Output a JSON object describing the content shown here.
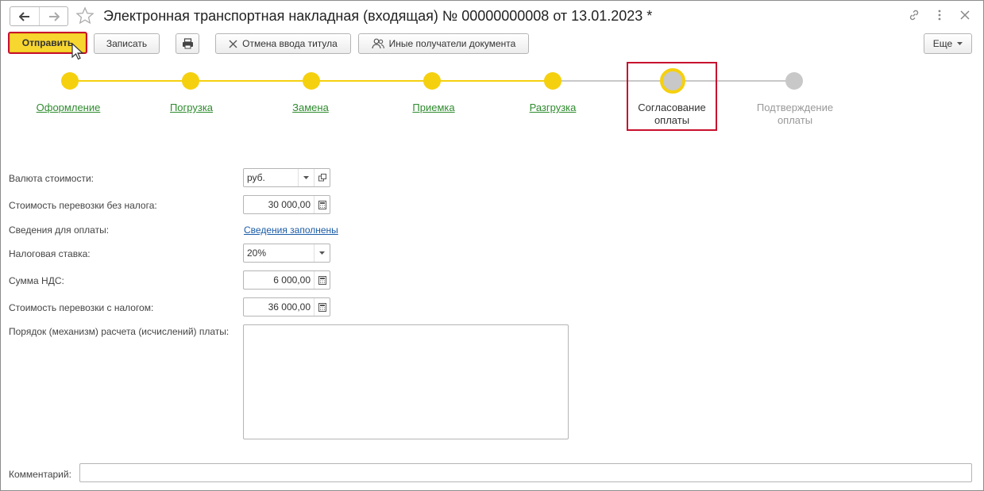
{
  "window": {
    "title": "Электронная транспортная накладная (входящая) № 00000000008 от 13.01.2023 *"
  },
  "toolbar": {
    "send_label": "Отправить",
    "save_label": "Записать",
    "cancel_title_label": "Отмена ввода титула",
    "other_recipients_label": "Иные получатели документа",
    "more_label": "Еще"
  },
  "stepper": {
    "steps": [
      {
        "label": "Оформление",
        "state": "done"
      },
      {
        "label": "Погрузка",
        "state": "done"
      },
      {
        "label": "Замена",
        "state": "done"
      },
      {
        "label": "Приемка",
        "state": "done"
      },
      {
        "label": "Разгрузка",
        "state": "done"
      },
      {
        "label": "Согласование оплаты",
        "state": "current"
      },
      {
        "label": "Подтверждение оплаты",
        "state": "pending"
      }
    ]
  },
  "form": {
    "currency_label": "Валюта стоимости:",
    "currency_value": "руб.",
    "cost_no_tax_label": "Стоимость перевозки без налога:",
    "cost_no_tax_value": "30 000,00",
    "payment_info_label": "Сведения для оплаты:",
    "payment_info_link": "Сведения заполнены",
    "tax_rate_label": "Налоговая ставка:",
    "tax_rate_value": "20%",
    "vat_label": "Сумма НДС:",
    "vat_value": "6 000,00",
    "cost_with_tax_label": "Стоимость перевозки с налогом:",
    "cost_with_tax_value": "36 000,00",
    "calc_order_label": "Порядок (механизм) расчета (исчислений) платы:",
    "calc_order_value": "",
    "comment_label": "Комментарий:",
    "comment_value": ""
  },
  "colors": {
    "accent_yellow": "#f5d00f",
    "highlight_red": "#c8102e",
    "done_link_green": "#2e8b2e",
    "link_blue": "#1a5ba6",
    "pending_gray": "#c8c8c8"
  }
}
